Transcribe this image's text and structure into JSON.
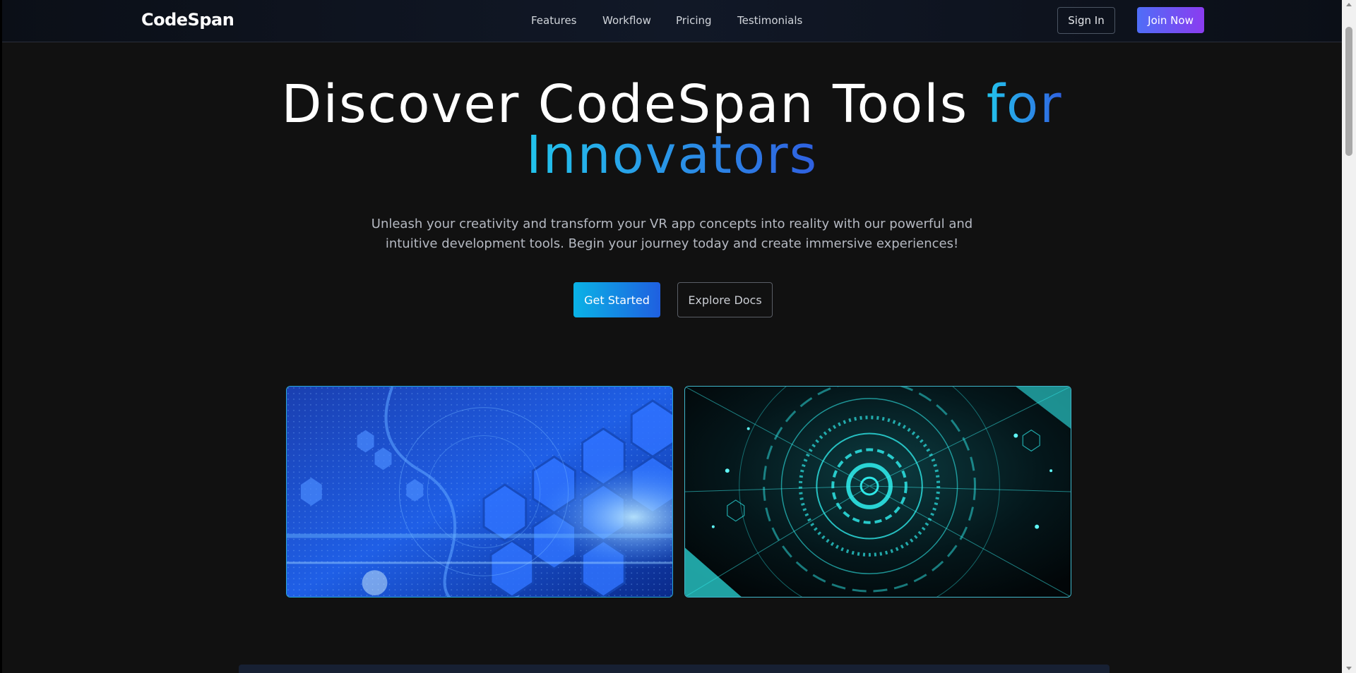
{
  "nav": {
    "logo": "CodeSpan",
    "links": [
      "Features",
      "Workflow",
      "Pricing",
      "Testimonials"
    ],
    "sign_in": "Sign In",
    "join_now": "Join Now"
  },
  "hero": {
    "title_part1": "Discover CodeSpan Tools ",
    "title_accent1": "for",
    "title_accent2": "Innovators",
    "subtitle_line1": "Unleash your creativity and transform your VR app concepts into reality with our powerful and",
    "subtitle_line2": "intuitive development tools. Begin your journey today and create immersive experiences!",
    "primary_cta": "Get Started",
    "secondary_cta": "Explore Docs"
  },
  "images": [
    {
      "name": "blue-hexagon-tech-image"
    },
    {
      "name": "cyan-circular-hud-image"
    }
  ],
  "colors": {
    "background": "#111111",
    "accent_cyan": "#22c4ec",
    "accent_blue": "#2f5fe0",
    "join_gradient_start": "#4f6ef7",
    "join_gradient_end": "#8b3cf0"
  }
}
